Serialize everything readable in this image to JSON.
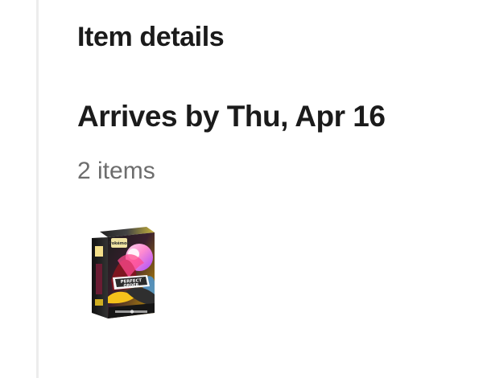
{
  "section": {
    "title": "Item details"
  },
  "shipment": {
    "arrival_label": "Arrives by Thu, Apr 16",
    "item_count_label": "2 items"
  },
  "product": {
    "image_alt": "Pokémon Perfect Order booster bundle"
  }
}
